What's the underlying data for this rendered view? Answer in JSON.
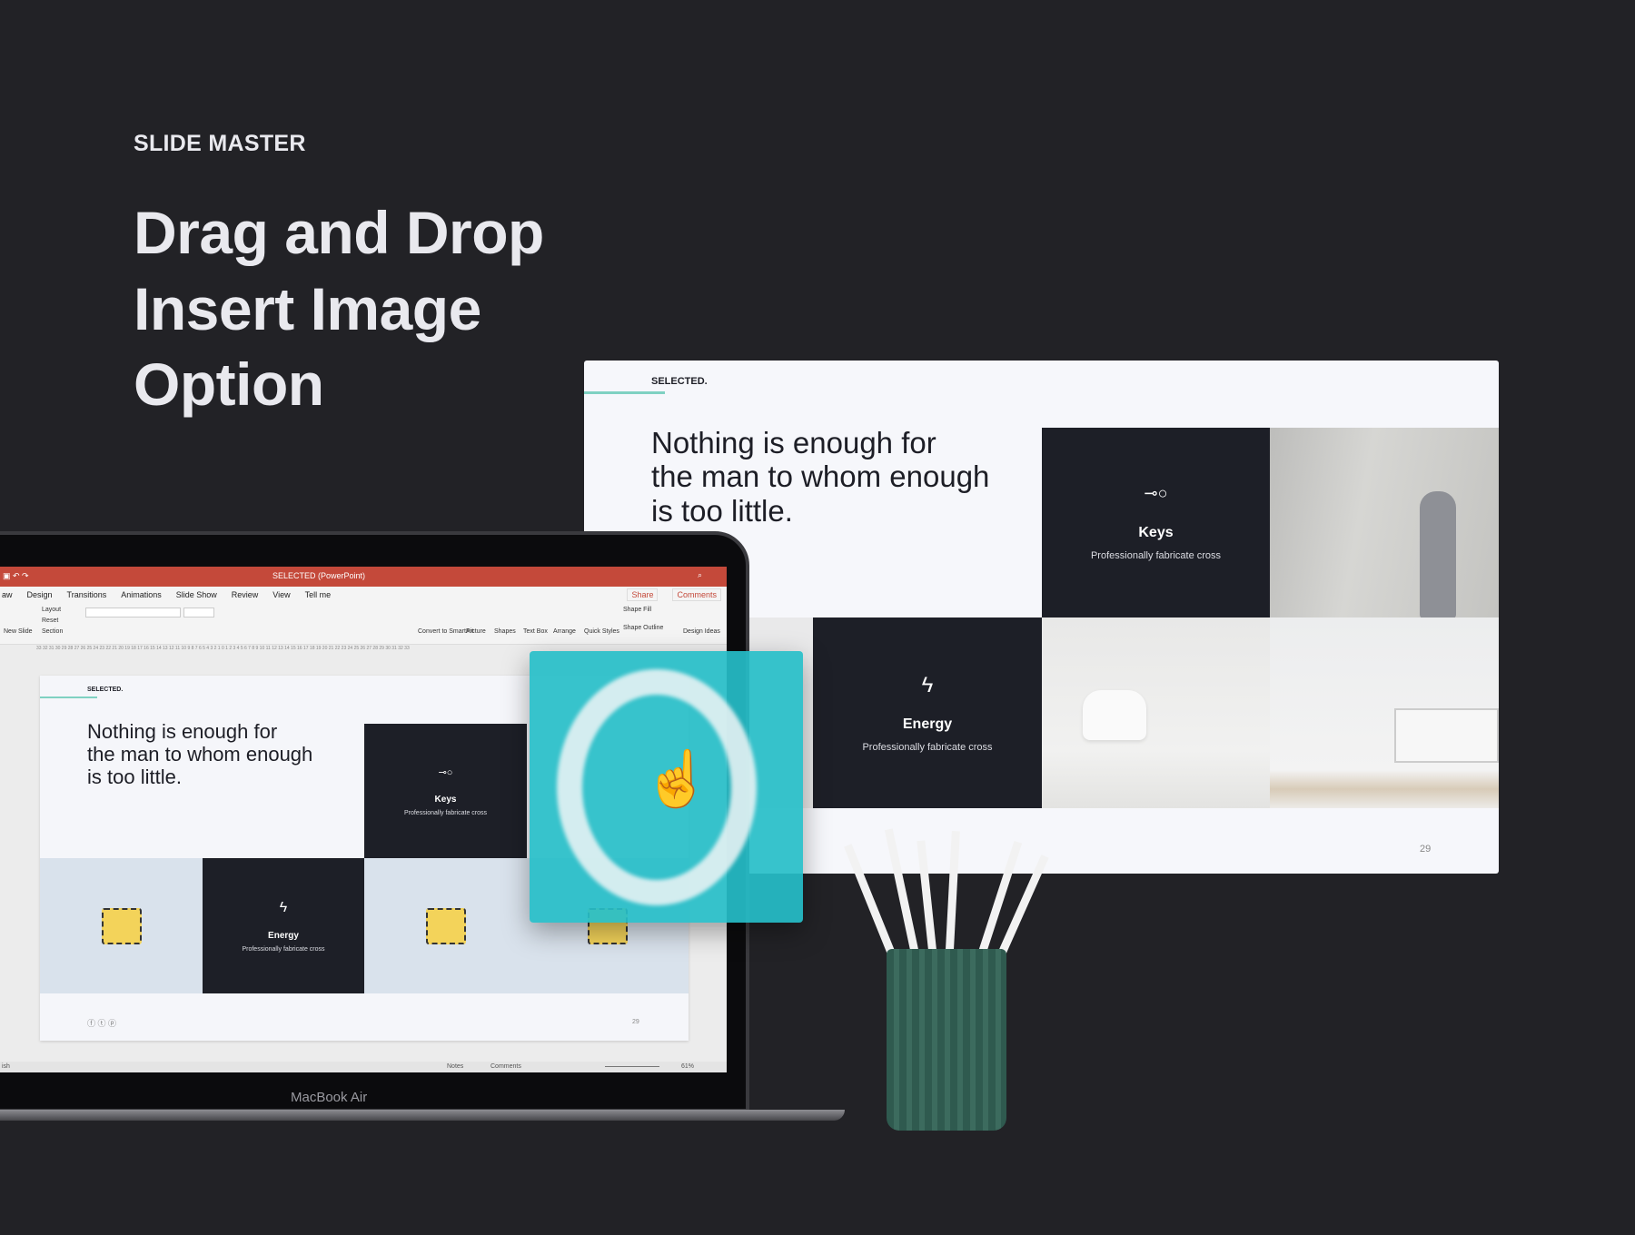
{
  "header": {
    "eyebrow": "SLIDE MASTER",
    "headline": [
      "Drag and Drop",
      "Insert Image",
      "Option"
    ]
  },
  "slide": {
    "tag": "SELECTED.",
    "quote": [
      "Nothing is enough for",
      "the man to whom enough",
      "is too little."
    ],
    "cards": [
      {
        "icon": "key-icon",
        "title": "Keys",
        "subtitle": "Professionally fabricate cross"
      },
      {
        "icon": "lightning-icon",
        "title": "Energy",
        "subtitle": "Professionally fabricate cross"
      }
    ],
    "page_number": "29",
    "accent": "#7fd1c2"
  },
  "powerpoint": {
    "window_title": "SELECTED (PowerPoint)",
    "tabs": [
      "aw",
      "Design",
      "Transitions",
      "Animations",
      "Slide Show",
      "Review",
      "View",
      "Tell me"
    ],
    "share": "Share",
    "comments": "Comments",
    "ribbon": {
      "new_slide": "New Slide",
      "layout": "Layout",
      "reset": "Reset",
      "section": "Section",
      "convert": "Convert to SmartArt",
      "picture": "Picture",
      "shapes": "Shapes",
      "text_box": "Text Box",
      "arrange": "Arrange",
      "quick_styles": "Quick Styles",
      "shape_fill": "Shape Fill",
      "shape_outline": "Shape Outline",
      "design_ideas": "Design Ideas"
    },
    "ruler": "33 32 31 30 29 28 27 26 25 24 23 22 21 20 19 18 17 16 15 14 13 12 11 10 9 8 7 6 5 4 3 2 1 0 1 2 3 4 5 6 7 8 9 10 11 12 13 14 15 16 17 18 19 20 21 22 23 24 25 26 27 28 29 30 31 32 33",
    "status": {
      "language": "ish",
      "notes": "Notes",
      "comments": "Comments",
      "zoom": "61%"
    },
    "title_bar_color": "#c4493a"
  },
  "device": {
    "brand": "MacBook Air"
  }
}
